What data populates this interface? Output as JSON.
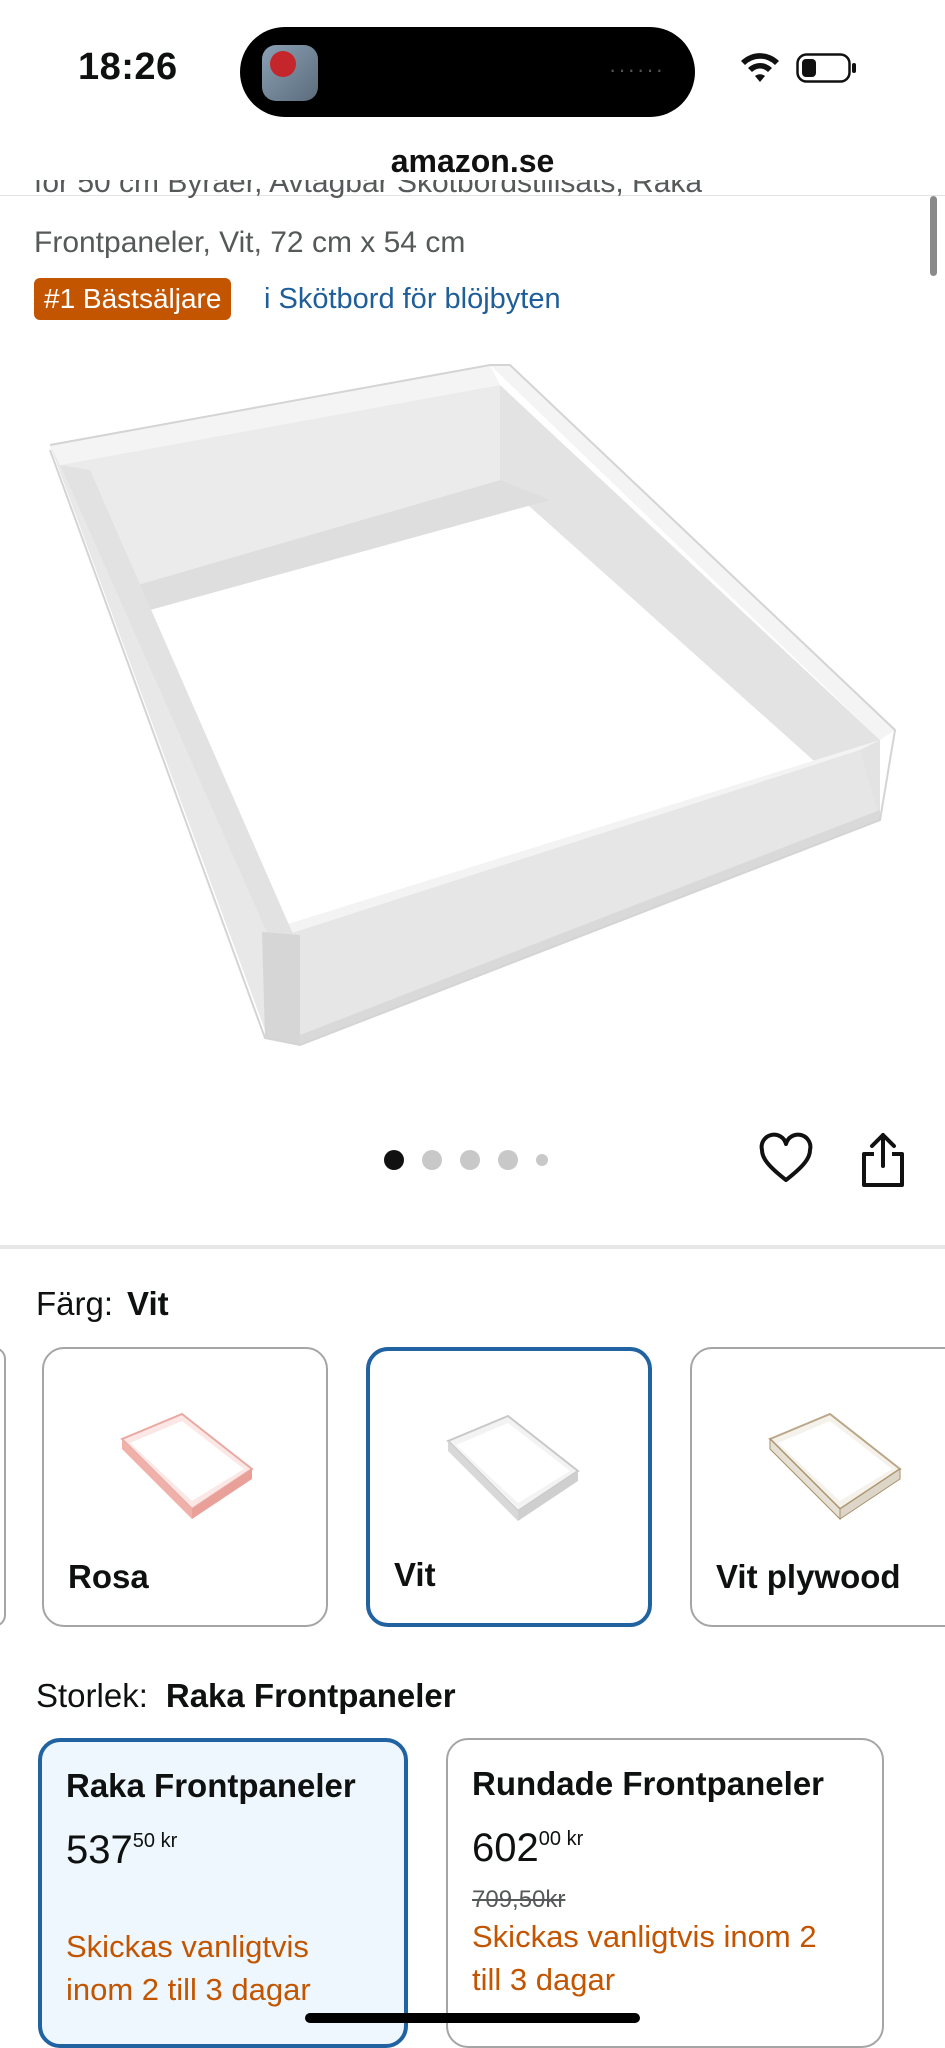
{
  "status_bar": {
    "time": "18:26",
    "island_dots": "······"
  },
  "browser": {
    "url": "amazon.se"
  },
  "product": {
    "title_cut": "för 50 cm Byråer, Avtagbar Skötbordstillsats, Raka",
    "title_line": "Frontpaneler, Vit, 72 cm x 54 cm",
    "badge": "#1 Bästsäljare",
    "category_link": "i Skötbord för blöjbyten"
  },
  "carousel": {
    "count": 5,
    "active_index": 0
  },
  "color": {
    "label": "Färg:",
    "selected": "Vit",
    "options": [
      {
        "label": "Rosa",
        "color": "#f1b9b3"
      },
      {
        "label": "Vit",
        "color": "#eeeeee"
      },
      {
        "label": "Vit plywood",
        "color": "#efebe4"
      }
    ]
  },
  "size": {
    "label": "Storlek:",
    "selected": "Raka Frontpaneler",
    "options": [
      {
        "name": "Raka Frontpaneler",
        "price_main": "537",
        "price_frac": "50",
        "currency": "kr",
        "old_price": "",
        "ship_line1": "Skickas vanligtvis",
        "ship_line2": "inom 2 till 3 dagar"
      },
      {
        "name": "Rundade Frontpaneler",
        "price_main": "602",
        "price_frac": "00",
        "currency": "kr",
        "old_price": "709,50kr",
        "ship_line1": "Skickas vanligtvis inom 2",
        "ship_line2": "till 3 dagar"
      }
    ]
  },
  "colors": {
    "accent_blue": "#2162a1",
    "badge_orange": "#c45500",
    "link_blue": "#1f5e99"
  }
}
